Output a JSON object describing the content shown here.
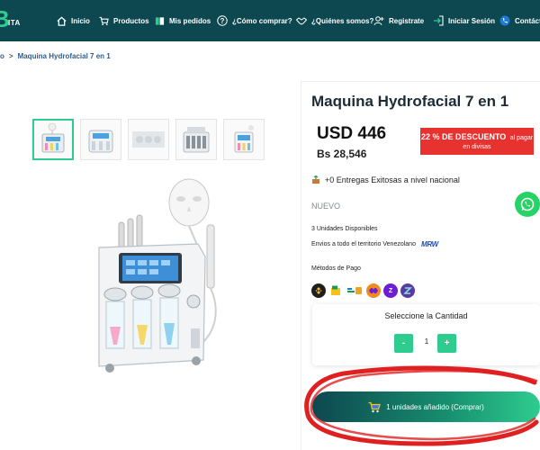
{
  "brand": {
    "logo_letter": "B",
    "logo_text": "ITA"
  },
  "nav": [
    {
      "label": "Inicio",
      "icon": "home-icon"
    },
    {
      "label": "Productos",
      "icon": "cart-icon"
    },
    {
      "label": "Mis pedidos",
      "icon": "orders-icon"
    },
    {
      "label": "¿Cómo comprar?",
      "icon": "question-icon"
    },
    {
      "label": "¿Quiénes somos?",
      "icon": "handshake-icon"
    },
    {
      "label": "Registrate",
      "icon": "user-add-icon"
    },
    {
      "label": "Iniciar Sesión",
      "icon": "login-icon"
    },
    {
      "label": "Contácto",
      "icon": "phone-icon"
    }
  ],
  "breadcrumb": {
    "home": "o",
    "separator": ">",
    "current": "Maquina Hydrofacial 7 en 1"
  },
  "product": {
    "title": "Maquina Hydrofacial 7 en 1",
    "price_usd": "USD 446",
    "price_bs": "Bs 28,546",
    "discount_main": "22 % DE DESCUENTO",
    "discount_suffix": "al pagar",
    "discount_sub": "en divisas",
    "deliveries": "+0 Entregas Exitosas a nivel nacional",
    "condition": "NUEVO",
    "units": "3 Unidades Disponibles",
    "shipping": "Envios a todo el territorio Venezolano",
    "shipping_carrier": "MRW",
    "payment_label": "Métodos de Pago",
    "payment_methods": [
      {
        "name": "binance-icon",
        "color": "#f3ba2f"
      },
      {
        "name": "banesco-icon",
        "color": "#1e9e4a"
      },
      {
        "name": "zelle-icon",
        "color": "#6d1ed4"
      }
    ]
  },
  "quantity": {
    "title": "Seleccione la Cantidad",
    "minus": "-",
    "value": "1",
    "plus": "+"
  },
  "buy_button": {
    "label": "1 unidades añadido (Comprar)"
  },
  "thumbnails_count": 5,
  "colors": {
    "nav_bg": "#0d4750",
    "accent": "#2ecc8f",
    "discount": "#e8322f",
    "annotation": "#e02020"
  }
}
